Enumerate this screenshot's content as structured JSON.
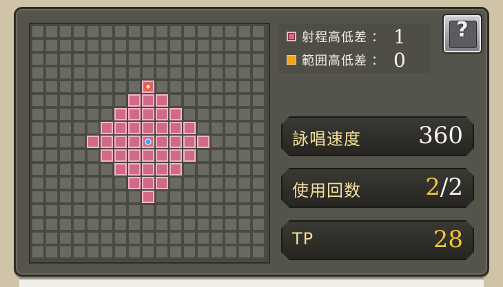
{
  "legend": {
    "range_height": {
      "label": "射程高低差",
      "colon": "：",
      "value": "1",
      "color": "#d16a86"
    },
    "area_height": {
      "label": "範囲高低差",
      "colon": "：",
      "value": "0",
      "color": "#f3a51c"
    }
  },
  "help_button": {
    "glyph": "?",
    "icon": "help-book-icon"
  },
  "stats": {
    "cast_speed": {
      "label": "詠唱速度",
      "value": "360"
    },
    "uses": {
      "label": "使用回数",
      "current": "2",
      "separator": "/",
      "max": "2"
    },
    "tp": {
      "label": "TP",
      "value": "28"
    }
  },
  "range_grid": {
    "columns": 17,
    "rows": 17,
    "caster_cell": {
      "col": 8,
      "row": 8
    },
    "target_cell": {
      "col": 8,
      "row": 4
    },
    "range_radius": 4,
    "colors": {
      "empty": "#6a6962",
      "range": "#d16a86",
      "caster": "#2aa8ff",
      "target": "#ff4a1a"
    }
  }
}
